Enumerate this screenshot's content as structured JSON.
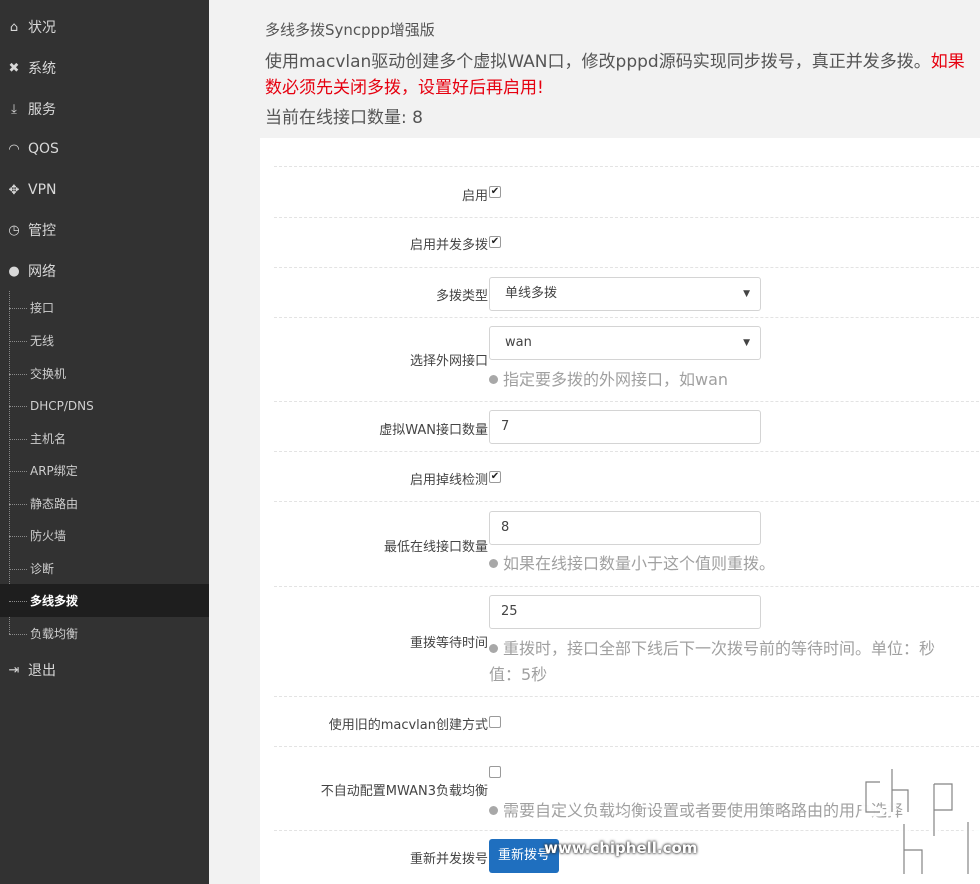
{
  "sidebar": {
    "top_items": [
      {
        "label": "状况",
        "icon": "home-icon"
      },
      {
        "label": "系统",
        "icon": "tools-icon"
      },
      {
        "label": "服务",
        "icon": "download-icon"
      },
      {
        "label": "QOS",
        "icon": "gauge-icon"
      },
      {
        "label": "VPN",
        "icon": "arrows-icon"
      },
      {
        "label": "管控",
        "icon": "check-circle-icon"
      },
      {
        "label": "网络",
        "icon": "globe-icon"
      }
    ],
    "sub_items": [
      "接口",
      "无线",
      "交换机",
      "DHCP/DNS",
      "主机名",
      "ARP绑定",
      "静态路由",
      "防火墙",
      "诊断",
      "多线多拨",
      "负载均衡"
    ],
    "active_sub": "多线多拨",
    "logout": {
      "label": "退出",
      "icon": "logout-icon"
    }
  },
  "main": {
    "title": "多线多拨Syncppp增强版",
    "description_plain": "使用macvlan驱动创建多个虚拟WAN口，修改pppd源码实现同步拨号，真正并发多拨。",
    "description_red_1": "如果",
    "description_red_2": "数必须先关闭多拨，设置好后再启用!",
    "online_count_text": "当前在线接口数量: 8"
  },
  "form": {
    "enable": {
      "label": "启用",
      "checked": true
    },
    "enable_concurrent": {
      "label": "启用并发多拨",
      "checked": true
    },
    "dial_type": {
      "label": "多拨类型",
      "value": "单线多拨"
    },
    "wan_interface": {
      "label": "选择外网接口",
      "value": "wan",
      "hint": "指定要多拨的外网接口，如wan"
    },
    "virtual_wan_count": {
      "label": "虚拟WAN接口数量",
      "value": "7"
    },
    "enable_drop_detect": {
      "label": "启用掉线检测",
      "checked": true
    },
    "min_online": {
      "label": "最低在线接口数量",
      "value": "8",
      "hint": "如果在线接口数量小于这个值则重拨。"
    },
    "redial_wait": {
      "label": "重拨等待时间",
      "value": "25",
      "hint_line1": "重拨时，接口全部下线后下一次拨号前的等待时间。单位：秒",
      "hint_line2": "值：5秒"
    },
    "old_macvlan": {
      "label": "使用旧的macvlan创建方式",
      "checked": false
    },
    "no_mwan3": {
      "label": "不自动配置MWAN3负载均衡",
      "checked": false,
      "hint": "需要自定义负载均衡设置或者要使用策略路由的用户选择"
    },
    "redial": {
      "label": "重新并发拨号",
      "button": "重新拨号"
    }
  },
  "watermark": {
    "url": "www.chiphell.com"
  }
}
